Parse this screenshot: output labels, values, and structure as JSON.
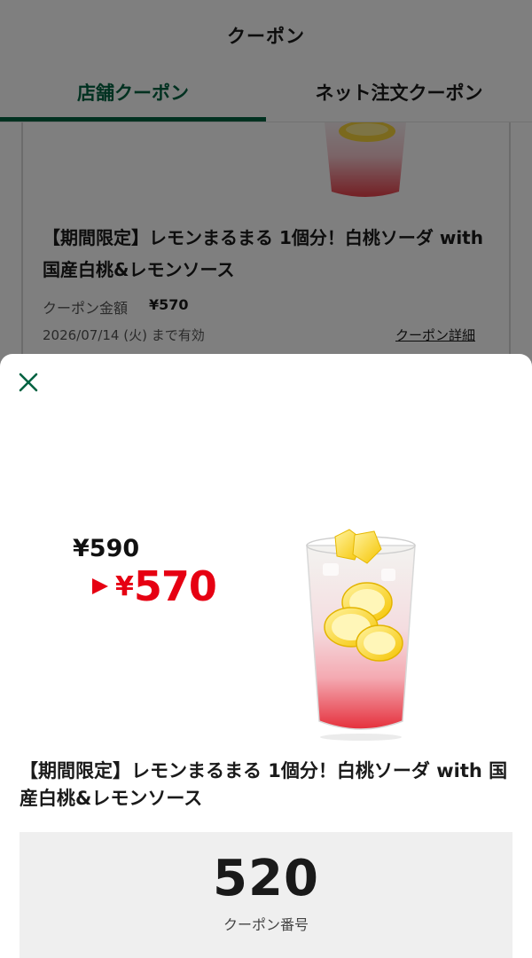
{
  "header": {
    "title": "クーポン"
  },
  "tabs": [
    {
      "label": "店舗クーポン",
      "active": true
    },
    {
      "label": "ネット注文クーポン",
      "active": false
    }
  ],
  "card": {
    "title": "【期間限定】レモンまるまる 1個分！白桃ソーダ with 国産白桃&レモンソース",
    "amount_label": "クーポン金額",
    "amount_value": "¥570",
    "expiry": "2026/07/14 (火) まで有効",
    "detail_link": "クーポン詳細"
  },
  "sheet": {
    "close_icon": "close-icon",
    "price_old": "¥590",
    "price_new_yen": "¥",
    "price_new": "570",
    "title": "【期間限定】レモンまるまる 1個分！白桃ソーダ with 国産白桃&レモンソース",
    "code_number": "520",
    "code_label": "クーポン番号"
  },
  "colors": {
    "brand_green": "#006241",
    "price_red": "#e60012",
    "overlay": "rgba(0,0,0,0.5)",
    "code_box_bg": "#efefef"
  }
}
